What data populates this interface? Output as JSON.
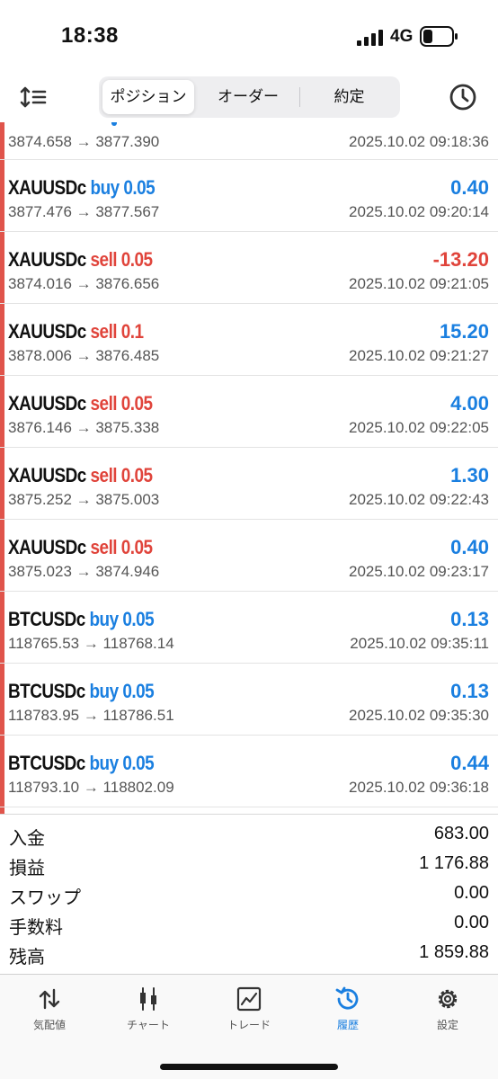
{
  "status_bar": {
    "time": "18:38",
    "network": "4G"
  },
  "toolbar": {
    "tabs": [
      {
        "label": "ポジション",
        "active": true
      },
      {
        "label": "オーダー",
        "active": false
      },
      {
        "label": "約定",
        "active": false
      }
    ]
  },
  "partial_row": {
    "prices": "3874.658 → 3877.390",
    "time": "2025.10.02 09:18:36"
  },
  "deals": [
    {
      "symbol": "XAUUSDc",
      "type": "buy 0.05",
      "side": "buy",
      "profit": "0.40",
      "prices": "3877.476 → 3877.567",
      "time": "2025.10.02 09:20:14"
    },
    {
      "symbol": "XAUUSDc",
      "type": "sell 0.05",
      "side": "sell",
      "profit": "-13.20",
      "prices": "3874.016 → 3876.656",
      "time": "2025.10.02 09:21:05"
    },
    {
      "symbol": "XAUUSDc",
      "type": "sell 0.1",
      "side": "sell",
      "profit": "15.20",
      "prices": "3878.006 → 3876.485",
      "time": "2025.10.02 09:21:27"
    },
    {
      "symbol": "XAUUSDc",
      "type": "sell 0.05",
      "side": "sell",
      "profit": "4.00",
      "prices": "3876.146 → 3875.338",
      "time": "2025.10.02 09:22:05"
    },
    {
      "symbol": "XAUUSDc",
      "type": "sell 0.05",
      "side": "sell",
      "profit": "1.30",
      "prices": "3875.252 → 3875.003",
      "time": "2025.10.02 09:22:43"
    },
    {
      "symbol": "XAUUSDc",
      "type": "sell 0.05",
      "side": "sell",
      "profit": "0.40",
      "prices": "3875.023 → 3874.946",
      "time": "2025.10.02 09:23:17"
    },
    {
      "symbol": "BTCUSDc",
      "type": "buy 0.05",
      "side": "buy",
      "profit": "0.13",
      "prices": "118765.53 → 118768.14",
      "time": "2025.10.02 09:35:11"
    },
    {
      "symbol": "BTCUSDc",
      "type": "buy 0.05",
      "side": "buy",
      "profit": "0.13",
      "prices": "118783.95 → 118786.51",
      "time": "2025.10.02 09:35:30"
    },
    {
      "symbol": "BTCUSDc",
      "type": "buy 0.05",
      "side": "buy",
      "profit": "0.44",
      "prices": "118793.10 → 118802.09",
      "time": "2025.10.02 09:36:18"
    }
  ],
  "summary": [
    {
      "label": "入金",
      "value": "683.00"
    },
    {
      "label": "損益",
      "value": "1 176.88"
    },
    {
      "label": "スワップ",
      "value": "0.00"
    },
    {
      "label": "手数料",
      "value": "0.00"
    },
    {
      "label": "残高",
      "value": "1 859.88"
    }
  ],
  "tabbar": [
    {
      "label": "気配値",
      "icon": "quotes-icon",
      "active": false
    },
    {
      "label": "チャート",
      "icon": "chart-icon",
      "active": false
    },
    {
      "label": "トレード",
      "icon": "trade-icon",
      "active": false
    },
    {
      "label": "履歴",
      "icon": "history-icon",
      "active": true
    },
    {
      "label": "設定",
      "icon": "settings-icon",
      "active": false
    }
  ],
  "colors": {
    "buy": "#1a7fe0",
    "sell": "#e0443b",
    "accent_bar": "#e0544b",
    "active_tab": "#1a7fe0"
  }
}
